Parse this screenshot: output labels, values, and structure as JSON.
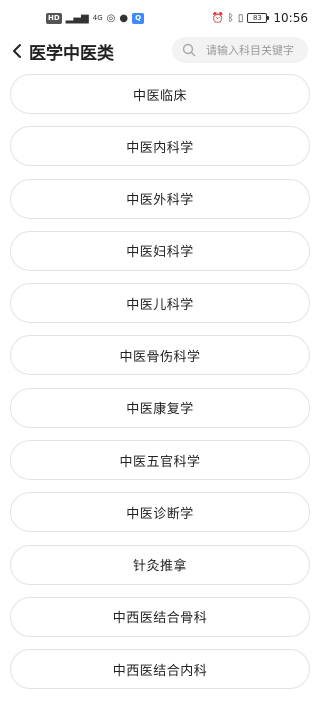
{
  "status_bar": {
    "hd_label": "HD",
    "network_label": "4G",
    "time": "10:56",
    "battery": "83"
  },
  "header": {
    "title": "医学中医类"
  },
  "search": {
    "placeholder": "请输入科目关键字"
  },
  "subjects": [
    {
      "label": "中医临床"
    },
    {
      "label": "中医内科学"
    },
    {
      "label": "中医外科学"
    },
    {
      "label": "中医妇科学"
    },
    {
      "label": "中医儿科学"
    },
    {
      "label": "中医骨伤科学"
    },
    {
      "label": "中医康复学"
    },
    {
      "label": "中医五官科学"
    },
    {
      "label": "中医诊断学"
    },
    {
      "label": "针灸推拿"
    },
    {
      "label": "中西医结合骨科"
    },
    {
      "label": "中西医结合内科"
    }
  ]
}
